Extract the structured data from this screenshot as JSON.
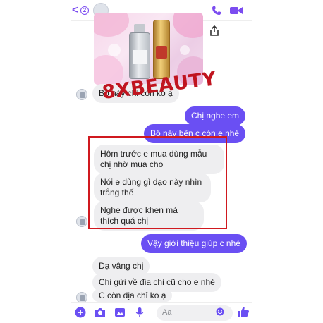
{
  "header": {
    "back_glyph": "<",
    "unread_count": "2",
    "icons": [
      "back-icon",
      "phone-icon",
      "video-icon"
    ]
  },
  "shared_image": {
    "share_icon": "share-icon"
  },
  "watermark": "8XBEAUTY",
  "messages": [
    {
      "side": "in",
      "text": "Bộ này chị còn ko ạ"
    },
    {
      "side": "out",
      "text": "Chị nghe em"
    },
    {
      "side": "out",
      "text": "Bộ này bên c còn e nhé"
    },
    {
      "side": "in",
      "text": "Hôm trước e mua dùng mẫu chị nhờ mua cho"
    },
    {
      "side": "in",
      "text": "Nói e dùng gì dạo này nhìn trắng thế"
    },
    {
      "side": "in",
      "text": "Nghe được khen mà thích quá chị"
    },
    {
      "side": "out",
      "text": "Vậy giới thiệu giúp c nhé"
    },
    {
      "side": "in",
      "text": "Dạ vâng chị"
    },
    {
      "side": "in",
      "text": "Chị gửi về địa chỉ cũ cho e nhé"
    },
    {
      "side": "in",
      "text": "C còn địa chỉ ko ạ"
    }
  ],
  "composer": {
    "placeholder": "Aa",
    "icons": [
      "plus-icon",
      "camera-icon",
      "gallery-icon",
      "mic-icon",
      "emoji-icon",
      "thumbs-up-icon"
    ]
  },
  "colors": {
    "accent": "#6a4ff3",
    "incoming": "#eeeef0",
    "highlight_box": "#d0191f",
    "watermark": "#c0141f"
  }
}
